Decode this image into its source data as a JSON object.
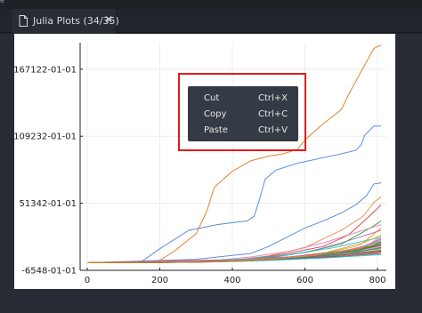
{
  "window": {
    "top_clip_text": "e"
  },
  "tab": {
    "title": "Julia Plots (34/35)",
    "close_glyph": "✕"
  },
  "context_menu": {
    "items": [
      {
        "label": "Cut",
        "shortcut": "Ctrl+X"
      },
      {
        "label": "Copy",
        "shortcut": "Ctrl+C"
      },
      {
        "label": "Paste",
        "shortcut": "Ctrl+V"
      }
    ]
  },
  "colors": {
    "highlight_box": "#e21b1b",
    "menu_bg": "#353b45",
    "series_orange": "#e1852f",
    "series_blue": "#5b8fe0"
  },
  "chart_data": {
    "type": "line",
    "title": "",
    "xlabel": "",
    "ylabel": "",
    "xlim": [
      0,
      800
    ],
    "ylim": [
      "-6548-01-01",
      "190000-01-01"
    ],
    "x_ticks": [
      0,
      200,
      400,
      600,
      800
    ],
    "y_ticks": [
      "-6548-01-01",
      "51342-01-01",
      "109232-01-01",
      "167122-01-01"
    ],
    "grid": true,
    "legend": "none",
    "series": [
      {
        "color": "#e1852f",
        "x": [
          0,
          100,
          200,
          240,
          300,
          330,
          350,
          400,
          450,
          500,
          540,
          580,
          600,
          650,
          700,
          720,
          760,
          790,
          810
        ],
        "y": [
          "0000-01-01",
          "0000-01-01",
          "2000-01-01",
          "10000-01-01",
          "25000-01-01",
          "45000-01-01",
          "65000-01-01",
          "79000-01-01",
          "88000-01-01",
          "92000-01-01",
          "94000-01-01",
          "98000-01-01",
          "106000-01-01",
          "120000-01-01",
          "132000-01-01",
          "145000-01-01",
          "168000-01-01",
          "185000-01-01",
          "188000-01-01"
        ]
      },
      {
        "color": "#5b8fe0",
        "x": [
          0,
          150,
          200,
          280,
          360,
          410,
          440,
          460,
          475,
          490,
          520,
          580,
          640,
          700,
          740,
          755,
          765,
          790,
          810
        ],
        "y": [
          "0000-01-01",
          "1000-01-01",
          "12000-01-01",
          "28000-01-01",
          "33000-01-01",
          "35000-01-01",
          "36000-01-01",
          "40000-01-01",
          "55000-01-01",
          "72000-01-01",
          "80000-01-01",
          "86000-01-01",
          "90000-01-01",
          "94000-01-01",
          "97000-01-01",
          "102000-01-01",
          "110000-01-01",
          "118000-01-01",
          "118000-01-01"
        ]
      },
      {
        "color": "#5b8fe0",
        "x": [
          0,
          300,
          450,
          500,
          550,
          600,
          650,
          700,
          740,
          770,
          790,
          810
        ],
        "y": [
          "0000-01-01",
          "3000-01-01",
          "8000-01-01",
          "14000-01-01",
          "22000-01-01",
          "30000-01-01",
          "36000-01-01",
          "43000-01-01",
          "50000-01-01",
          "58000-01-01",
          "68000-01-01",
          "69000-01-01"
        ]
      },
      {
        "color": "#e1852f",
        "x": [
          0,
          400,
          500,
          600,
          700,
          760,
          790,
          810
        ],
        "y": [
          "0000-01-01",
          "2000-01-01",
          "6000-01-01",
          "13000-01-01",
          "28000-01-01",
          "40000-01-01",
          "52000-01-01",
          "57000-01-01"
        ]
      },
      {
        "color": "#d62728",
        "x": [
          0,
          450,
          550,
          650,
          720,
          770,
          810
        ],
        "y": [
          "0000-01-01",
          "3000-01-01",
          "8000-01-01",
          "14000-01-01",
          "24000-01-01",
          "38000-01-01",
          "50000-01-01"
        ]
      },
      {
        "color": "#2ca02c",
        "x": [
          0,
          380,
          500,
          600,
          700,
          780,
          810
        ],
        "y": [
          "0000-01-01",
          "1500-01-01",
          "4500-01-01",
          "9000-01-01",
          "16000-01-01",
          "30000-01-01",
          "36000-01-01"
        ]
      },
      {
        "color": "#e377c2",
        "x": [
          0,
          350,
          450,
          560,
          660,
          740,
          810
        ],
        "y": [
          "0000-01-01",
          "2000-01-01",
          "5000-01-01",
          "10000-01-01",
          "18000-01-01",
          "26000-01-01",
          "33000-01-01"
        ]
      },
      {
        "color": "#9467bd",
        "x": [
          0,
          420,
          520,
          620,
          720,
          810
        ],
        "y": [
          "0000-01-01",
          "1500-01-01",
          "5000-01-01",
          "10000-01-01",
          "19000-01-01",
          "28000-01-01"
        ]
      },
      {
        "color": "#17becf",
        "x": [
          0,
          300,
          450,
          560,
          680,
          810
        ],
        "y": [
          "0000-01-01",
          "1000-01-01",
          "3500-01-01",
          "7000-01-01",
          "13000-01-01",
          "22000-01-01"
        ]
      },
      {
        "color": "#bcbd22",
        "x": [
          0,
          380,
          520,
          640,
          740,
          810
        ],
        "y": [
          "0000-01-01",
          "1000-01-01",
          "3000-01-01",
          "7500-01-01",
          "14000-01-01",
          "24000-01-01"
        ]
      },
      {
        "color": "#8c564b",
        "x": [
          0,
          330,
          480,
          600,
          720,
          810
        ],
        "y": [
          "0000-01-01",
          "800-01-01",
          "2500-01-01",
          "6000-01-01",
          "11000-01-01",
          "18000-01-01"
        ]
      },
      {
        "color": "#ff7f0e",
        "x": [
          0,
          420,
          540,
          660,
          760,
          810
        ],
        "y": [
          "0000-01-01",
          "1200-01-01",
          "4000-01-01",
          "9000-01-01",
          "17000-01-01",
          "30000-01-01"
        ]
      },
      {
        "color": "#1f77b4",
        "x": [
          0,
          250,
          400,
          550,
          700,
          810
        ],
        "y": [
          "0000-01-01",
          "500-01-01",
          "2000-01-01",
          "4500-01-01",
          "9000-01-01",
          "15000-01-01"
        ]
      },
      {
        "color": "#2ca02c",
        "x": [
          0,
          200,
          350,
          500,
          650,
          810
        ],
        "y": [
          "0000-01-01",
          "300-01-01",
          "1500-01-01",
          "3500-01-01",
          "7000-01-01",
          "12000-01-01"
        ]
      },
      {
        "color": "#d62728",
        "x": [
          0,
          260,
          420,
          560,
          700,
          810
        ],
        "y": [
          "0000-01-01",
          "600-01-01",
          "2200-01-01",
          "5200-01-01",
          "9500-01-01",
          "16000-01-01"
        ]
      },
      {
        "color": "#9467bd",
        "x": [
          0,
          180,
          330,
          480,
          640,
          810
        ],
        "y": [
          "0000-01-01",
          "200-01-01",
          "900-01-01",
          "2600-01-01",
          "5500-01-01",
          "10000-01-01"
        ]
      },
      {
        "color": "#17becf",
        "x": [
          0,
          300,
          470,
          610,
          740,
          810
        ],
        "y": [
          "0000-01-01",
          "700-01-01",
          "2800-01-01",
          "6200-01-01",
          "12000-01-01",
          "20000-01-01"
        ]
      },
      {
        "color": "#e377c2",
        "x": [
          0,
          220,
          380,
          530,
          690,
          810
        ],
        "y": [
          "0000-01-01",
          "400-01-01",
          "1800-01-01",
          "4200-01-01",
          "8200-01-01",
          "13500-01-01"
        ]
      },
      {
        "color": "#7f7f7f",
        "x": [
          0,
          240,
          400,
          560,
          720,
          810
        ],
        "y": [
          "0000-01-01",
          "300-01-01",
          "1200-01-01",
          "3000-01-01",
          "6000-01-01",
          "9000-01-01"
        ]
      },
      {
        "color": "#bcbd22",
        "x": [
          0,
          280,
          440,
          590,
          720,
          810
        ],
        "y": [
          "0000-01-01",
          "500-01-01",
          "2000-01-01",
          "4800-01-01",
          "9500-01-01",
          "14500-01-01"
        ]
      },
      {
        "color": "#8c564b",
        "x": [
          0,
          200,
          360,
          510,
          670,
          810
        ],
        "y": [
          "0000-01-01",
          "200-01-01",
          "1000-01-01",
          "2600-01-01",
          "5000-01-01",
          "8000-01-01"
        ]
      },
      {
        "color": "#1f77b4",
        "x": [
          0,
          320,
          480,
          620,
          750,
          810
        ],
        "y": [
          "0000-01-01",
          "600-01-01",
          "2400-01-01",
          "5600-01-01",
          "11000-01-01",
          "17500-01-01"
        ]
      },
      {
        "color": "#2ca02c",
        "x": [
          0,
          260,
          420,
          570,
          710,
          810
        ],
        "y": [
          "0000-01-01",
          "400-01-01",
          "1600-01-01",
          "3800-01-01",
          "7200-01-01",
          "11000-01-01"
        ]
      },
      {
        "color": "#ff7f0e",
        "x": [
          0,
          230,
          390,
          540,
          690,
          810
        ],
        "y": [
          "0000-01-01",
          "300-01-01",
          "1300-01-01",
          "3300-01-01",
          "6600-01-01",
          "10500-01-01"
        ]
      },
      {
        "color": "#d62728",
        "x": [
          0,
          210,
          370,
          520,
          680,
          810
        ],
        "y": [
          "0000-01-01",
          "200-01-01",
          "1100-01-01",
          "2900-01-01",
          "5800-01-01",
          "9500-01-01"
        ]
      },
      {
        "color": "#9467bd",
        "x": [
          0,
          340,
          500,
          640,
          760,
          810
        ],
        "y": [
          "0000-01-01",
          "800-01-01",
          "3000-01-01",
          "6800-01-01",
          "13000-01-01",
          "21000-01-01"
        ]
      },
      {
        "color": "#17becf",
        "x": [
          0,
          190,
          350,
          500,
          660,
          810
        ],
        "y": [
          "0000-01-01",
          "150-01-01",
          "700-01-01",
          "2000-01-01",
          "4200-01-01",
          "7000-01-01"
        ]
      },
      {
        "color": "#e377c2",
        "x": [
          0,
          360,
          520,
          660,
          770,
          810
        ],
        "y": [
          "0000-01-01",
          "900-01-01",
          "3400-01-01",
          "7600-01-01",
          "14500-01-01",
          "23000-01-01"
        ]
      },
      {
        "color": "#7f7f7f",
        "x": [
          0,
          250,
          410,
          560,
          700,
          810
        ],
        "y": [
          "0000-01-01",
          "350-01-01",
          "1400-01-01",
          "3400-01-01",
          "6800-01-01",
          "10500-01-01"
        ]
      },
      {
        "color": "#bcbd22",
        "x": [
          0,
          270,
          430,
          580,
          720,
          810
        ],
        "y": [
          "0000-01-01",
          "450-01-01",
          "1700-01-01",
          "4100-01-01",
          "8000-01-01",
          "12500-01-01"
        ]
      },
      {
        "color": "#8c564b",
        "x": [
          0,
          300,
          460,
          600,
          730,
          810
        ],
        "y": [
          "0000-01-01",
          "550-01-01",
          "2100-01-01",
          "4900-01-01",
          "9700-01-01",
          "15000-01-01"
        ]
      },
      {
        "color": "#1f77b4",
        "x": [
          0,
          280,
          440,
          590,
          730,
          810
        ],
        "y": [
          "0000-01-01",
          "450-01-01",
          "1800-01-01",
          "4300-01-01",
          "8500-01-01",
          "13000-01-01"
        ]
      },
      {
        "color": "#2ca02c",
        "x": [
          0,
          310,
          470,
          610,
          740,
          810
        ],
        "y": [
          "0000-01-01",
          "600-01-01",
          "2300-01-01",
          "5400-01-01",
          "10500-01-01",
          "16500-01-01"
        ]
      },
      {
        "color": "#ff7f0e",
        "x": [
          0,
          330,
          490,
          630,
          750,
          810
        ],
        "y": [
          "0000-01-01",
          "700-01-01",
          "2700-01-01",
          "6200-01-01",
          "12000-01-01",
          "19000-01-01"
        ]
      }
    ]
  }
}
